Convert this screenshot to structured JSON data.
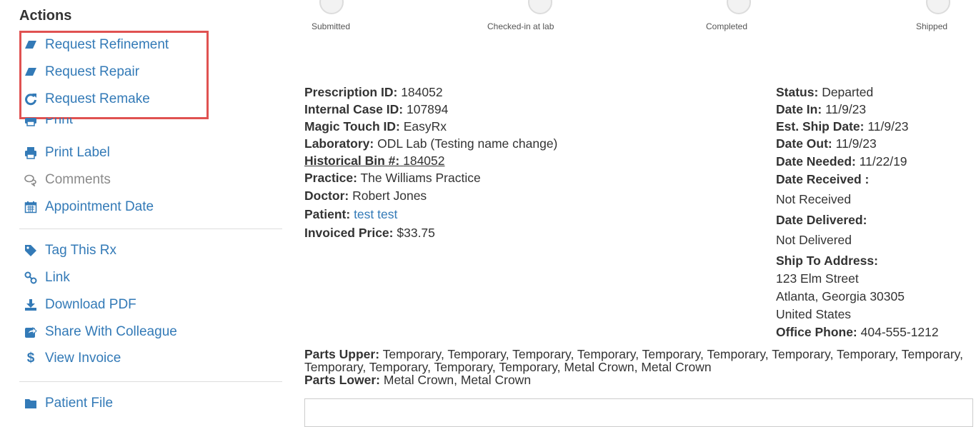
{
  "sidebar": {
    "title": "Actions",
    "items": [
      {
        "label": "Request Refinement"
      },
      {
        "label": "Request Repair"
      },
      {
        "label": "Request Remake"
      },
      {
        "label": "Print"
      },
      {
        "label": "Print Label"
      },
      {
        "label": "Comments"
      },
      {
        "label": "Appointment Date"
      },
      {
        "label": "Tag This Rx"
      },
      {
        "label": "Link"
      },
      {
        "label": "Download PDF"
      },
      {
        "label": "Share With Colleague"
      },
      {
        "label": "View Invoice"
      },
      {
        "label": "Patient File"
      }
    ],
    "highlight_color": "#e05251",
    "link_color": "#337ab7"
  },
  "progress": {
    "steps": [
      {
        "label": "Submitted"
      },
      {
        "label": "Checked-in at lab"
      },
      {
        "label": "Completed"
      },
      {
        "label": "Shipped"
      }
    ]
  },
  "details": {
    "prescription_id": {
      "label": "Prescription ID:",
      "value": "184052"
    },
    "internal_case_id": {
      "label": "Internal Case ID:",
      "value": "107894"
    },
    "magic_touch_id": {
      "label": "Magic Touch ID:",
      "value": "EasyRx"
    },
    "laboratory": {
      "label": "Laboratory:",
      "value": "ODL Lab (Testing name change)"
    },
    "historical_bin": {
      "label": "Historical Bin #:",
      "value": "184052"
    },
    "practice": {
      "label": "Practice:",
      "value": "The Williams Practice"
    },
    "doctor": {
      "label": "Doctor:",
      "value": "Robert Jones"
    },
    "patient": {
      "label": "Patient:",
      "value": "test test"
    },
    "invoiced_price": {
      "label": "Invoiced Price:",
      "value": "$33.75"
    }
  },
  "status": {
    "status": {
      "label": "Status:",
      "value": "Departed"
    },
    "date_in": {
      "label": "Date In:",
      "value": "11/9/23"
    },
    "est_ship_date": {
      "label": "Est. Ship Date:",
      "value": "11/9/23"
    },
    "date_out": {
      "label": "Date Out:",
      "value": "11/9/23"
    },
    "date_needed": {
      "label": "Date Needed:",
      "value": "11/22/19"
    },
    "date_received": {
      "label": "Date Received :",
      "value": "Not Received"
    },
    "date_delivered": {
      "label": "Date Delivered:",
      "value": "Not Delivered"
    },
    "ship_to": {
      "label": "Ship To Address:",
      "line1": "123 Elm Street",
      "line2": "Atlanta, Georgia 30305",
      "line3": "United States"
    },
    "office_phone": {
      "label": "Office Phone:",
      "value": "404-555-1212"
    }
  },
  "parts": {
    "upper_label": "Parts Upper:",
    "upper_value": "Temporary, Temporary, Temporary, Temporary, Temporary, Temporary, Temporary, Temporary, Temporary, Temporary, Temporary, Temporary, Temporary, Metal Crown, Metal Crown",
    "lower_label": "Parts Lower:",
    "lower_value": "Metal Crown, Metal Crown"
  },
  "icons": {
    "refinement": "eraser-icon",
    "repair": "eraser-icon",
    "remake": "redo-icon",
    "print": "print-icon",
    "print_label": "print-icon",
    "comments": "comments-icon",
    "appointment": "calendar-icon",
    "tag": "tag-icon",
    "link": "link-icon",
    "download": "download-icon",
    "share": "share-icon",
    "invoice": "dollar-icon",
    "patient_file": "folder-icon"
  }
}
